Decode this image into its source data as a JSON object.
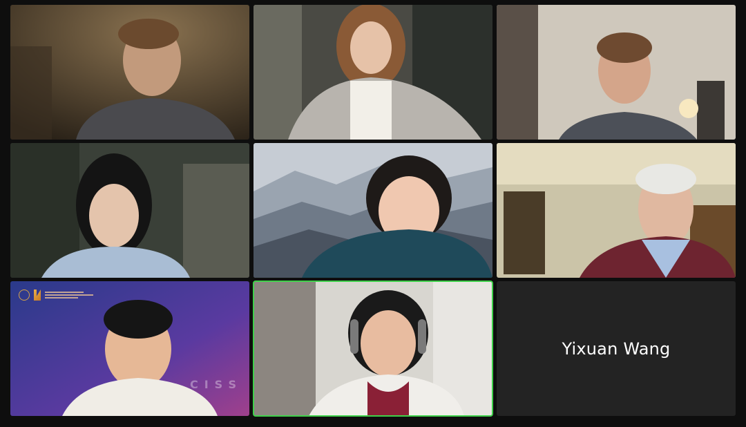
{
  "meeting": {
    "participants": [
      {
        "id": "p1",
        "camera": "on"
      },
      {
        "id": "p2",
        "camera": "on"
      },
      {
        "id": "p3",
        "camera": "on"
      },
      {
        "id": "p4",
        "camera": "on"
      },
      {
        "id": "p5",
        "camera": "on"
      },
      {
        "id": "p6",
        "camera": "on"
      },
      {
        "id": "p7",
        "camera": "on",
        "background_text": "CISS"
      },
      {
        "id": "p8",
        "camera": "on",
        "active_speaker": true
      },
      {
        "id": "p9",
        "camera": "off",
        "name": "Yixuan Wang"
      }
    ]
  },
  "colors": {
    "active_speaker_border": "#3fd14a",
    "grid_background": "#0e0e0e",
    "tile_off_background": "#232323"
  }
}
